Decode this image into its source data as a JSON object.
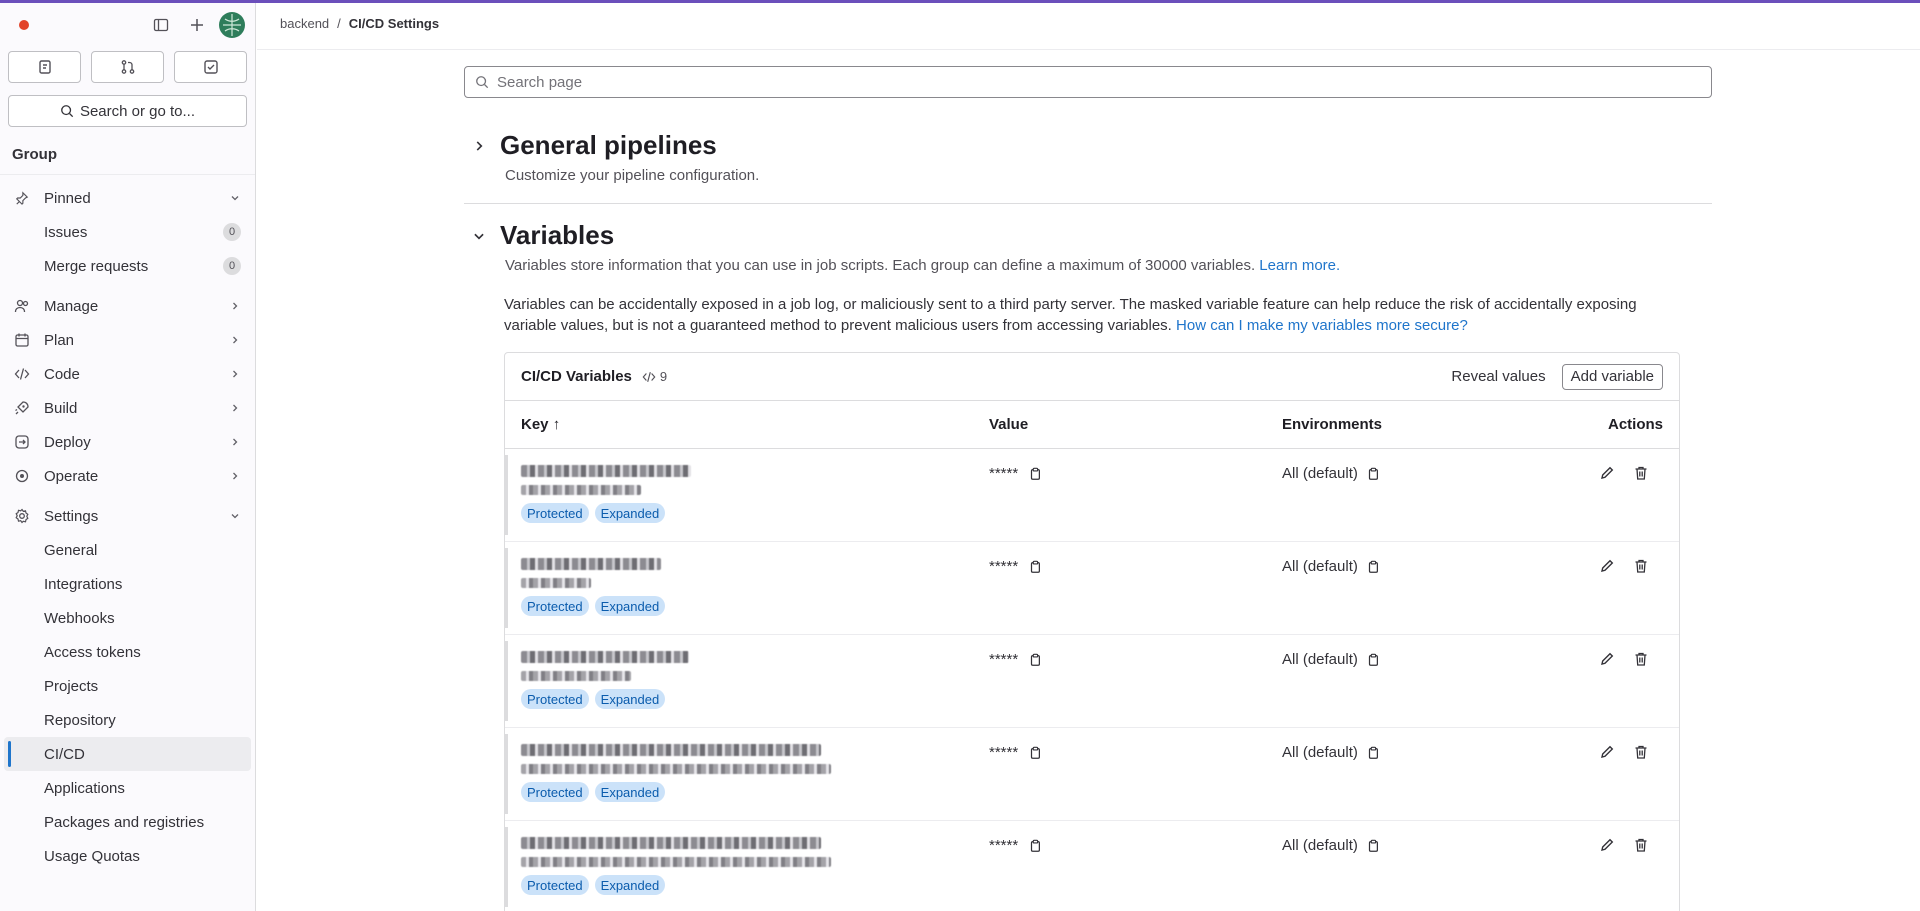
{
  "breadcrumb": {
    "parent": "backend",
    "separator": "/",
    "current": "CI/CD Settings"
  },
  "sidebar": {
    "search_label": "Search or go to...",
    "context": "Group",
    "pinned_label": "Pinned",
    "pinned": [
      {
        "label": "Issues",
        "count": "0"
      },
      {
        "label": "Merge requests",
        "count": "0"
      }
    ],
    "sections": [
      {
        "label": "Manage",
        "icon": "users-icon"
      },
      {
        "label": "Plan",
        "icon": "calendar-icon"
      },
      {
        "label": "Code",
        "icon": "code-icon"
      },
      {
        "label": "Build",
        "icon": "rocket-icon"
      },
      {
        "label": "Deploy",
        "icon": "deploy-icon"
      },
      {
        "label": "Operate",
        "icon": "cloud-icon"
      }
    ],
    "settings_label": "Settings",
    "settings_items": [
      {
        "label": "General"
      },
      {
        "label": "Integrations"
      },
      {
        "label": "Webhooks"
      },
      {
        "label": "Access tokens"
      },
      {
        "label": "Projects"
      },
      {
        "label": "Repository"
      },
      {
        "label": "CI/CD"
      },
      {
        "label": "Applications"
      },
      {
        "label": "Packages and registries"
      },
      {
        "label": "Usage Quotas"
      }
    ],
    "active_item": "CI/CD"
  },
  "main": {
    "search_placeholder": "Search page",
    "general": {
      "title": "General pipelines",
      "description": "Customize your pipeline configuration."
    },
    "variables": {
      "title": "Variables",
      "description": "Variables store information that you can use in job scripts. Each group can define a maximum of 30000 variables.",
      "learn_more": "Learn more.",
      "warning": "Variables can be accidentally exposed in a job log, or maliciously sent to a third party server. The masked variable feature can help reduce the risk of accidentally exposing variable values, but is not a guaranteed method to prevent malicious users from accessing variables.",
      "warning_link": "How can I make my variables more secure?"
    },
    "table": {
      "title": "CI/CD Variables",
      "count": "9",
      "reveal_label": "Reveal values",
      "add_label": "Add variable",
      "headers": {
        "key": "Key",
        "value": "Value",
        "environments": "Environments",
        "actions": "Actions"
      },
      "rows": [
        {
          "value": "*****",
          "environment": "All (default)",
          "tags": [
            "Protected",
            "Expanded"
          ]
        },
        {
          "value": "*****",
          "environment": "All (default)",
          "tags": [
            "Protected",
            "Expanded"
          ]
        },
        {
          "value": "*****",
          "environment": "All (default)",
          "tags": [
            "Protected",
            "Expanded"
          ]
        },
        {
          "value": "*****",
          "environment": "All (default)",
          "tags": [
            "Protected",
            "Expanded"
          ]
        },
        {
          "value": "*****",
          "environment": "All (default)",
          "tags": [
            "Protected",
            "Expanded"
          ]
        }
      ]
    }
  },
  "colors": {
    "accent": "#1f75cb",
    "brand_bar": "#6b4fbb",
    "tag_bg": "#cbe2f9",
    "tag_text": "#0b5cad"
  }
}
